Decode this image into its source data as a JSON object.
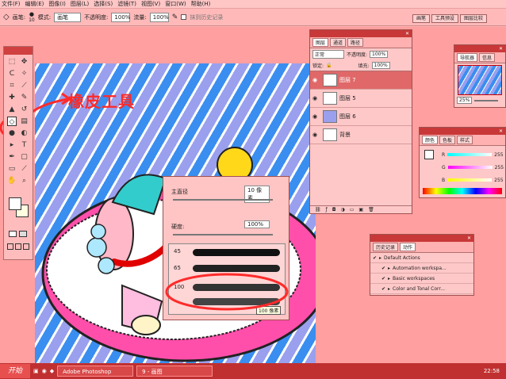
{
  "menu": [
    "文件(F)",
    "编辑(E)",
    "图像(I)",
    "图层(L)",
    "选择(S)",
    "滤镜(T)",
    "视图(V)",
    "窗口(W)",
    "帮助(H)"
  ],
  "options": {
    "brush_label": "画笔:",
    "brush_size": "10",
    "mode_label": "模式:",
    "mode_value": "画笔",
    "opacity_label": "不透明度:",
    "opacity_value": "100%",
    "flow_label": "流量:",
    "flow_value": "100%",
    "history_label": "抹到历史记录"
  },
  "palette_well": [
    "画笔",
    "工具预设",
    "图层比较"
  ],
  "layers_panel": {
    "tabs": [
      "图层",
      "通道",
      "路径"
    ],
    "blend_mode": "正常",
    "opacity_label": "不透明度:",
    "opacity_value": "100%",
    "lock_label": "锁定:",
    "fill_label": "填充:",
    "fill_value": "100%",
    "layers": [
      {
        "name": "图层 7"
      },
      {
        "name": "图层 5"
      },
      {
        "name": "图层 6"
      },
      {
        "name": "背景"
      }
    ]
  },
  "brush_popup": {
    "diameter_label": "主直径",
    "diameter_value": "10 像素",
    "hardness_label": "硬度:",
    "hardness_value": "100%",
    "sizes": [
      "45",
      "65",
      "100"
    ],
    "tooltip": "100 像素"
  },
  "annotation": "橡皮工具",
  "navigator": {
    "tabs": [
      "导航器",
      "信息"
    ],
    "zoom": "25%"
  },
  "color_panel": {
    "tabs": [
      "颜色",
      "色板",
      "样式"
    ],
    "channels": [
      "R",
      "G",
      "B"
    ],
    "values": [
      "255",
      "255",
      "255"
    ]
  },
  "actions_panel": {
    "tabs": [
      "历史记录",
      "动作"
    ],
    "items": [
      "Default Actions",
      "Automation workspa...",
      "Basic workspaces",
      "Color and Tonal Corr..."
    ]
  },
  "taskbar": {
    "start": "开始",
    "tasks": [
      "Adobe Photoshop",
      "9 - 画图"
    ],
    "time": "22:58"
  },
  "colors": {
    "accent": "#c83838",
    "annotation": "#ff2a2a"
  }
}
